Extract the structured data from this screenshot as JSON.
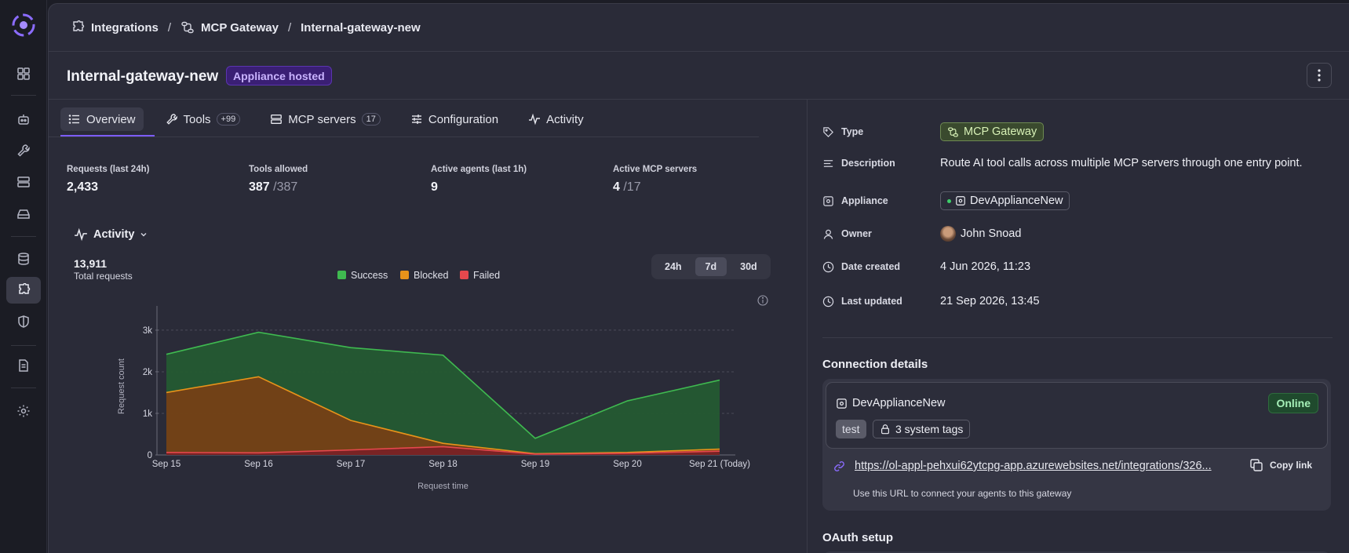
{
  "breadcrumb": {
    "items": [
      {
        "label": "Integrations",
        "icon": "puzzle-icon"
      },
      {
        "label": "MCP Gateway",
        "icon": "gateway-icon"
      },
      {
        "label": "Internal-gateway-new"
      }
    ],
    "separator": "/"
  },
  "page": {
    "title": "Internal-gateway-new",
    "hosted_badge": "Appliance hosted"
  },
  "tabs": [
    {
      "label": "Overview",
      "icon": "list-icon",
      "active": true
    },
    {
      "label": "Tools",
      "icon": "wrench-icon",
      "count": "+99"
    },
    {
      "label": "MCP servers",
      "icon": "server-icon",
      "count": "17"
    },
    {
      "label": "Configuration",
      "icon": "sliders-icon"
    },
    {
      "label": "Activity",
      "icon": "pulse-icon"
    }
  ],
  "metrics": [
    {
      "label": "Requests (last 24h)",
      "value": "2,433",
      "sub": ""
    },
    {
      "label": "Tools allowed",
      "value": "387",
      "sub": "/387"
    },
    {
      "label": "Active agents (last 1h)",
      "value": "9",
      "sub": ""
    },
    {
      "label": "Active MCP servers",
      "value": "4",
      "sub": "/17"
    }
  ],
  "activity": {
    "header": "Activity",
    "total_value": "13,911",
    "total_label": "Total requests",
    "ranges": [
      "24h",
      "7d",
      "30d"
    ],
    "selected_range": "7d"
  },
  "chart_data": {
    "type": "area",
    "x": [
      "Sep 15",
      "Sep 16",
      "Sep 17",
      "Sep 18",
      "Sep 19",
      "Sep 20",
      "Sep 21 (Today)"
    ],
    "series": [
      {
        "name": "Success",
        "color": "#3fb950",
        "values": [
          2420,
          2950,
          2580,
          2400,
          400,
          1300,
          1800
        ]
      },
      {
        "name": "Blocked",
        "color": "#e8931a",
        "values": [
          1500,
          1880,
          830,
          280,
          30,
          60,
          140
        ]
      },
      {
        "name": "Failed",
        "color": "#e5484d",
        "values": [
          60,
          50,
          120,
          200,
          20,
          40,
          90
        ]
      }
    ],
    "y_ticks": [
      "0",
      "1k",
      "2k",
      "3k"
    ],
    "ylim": [
      0,
      3300
    ],
    "xlabel": "Request time",
    "ylabel": "Request count",
    "legend_position": "top-center",
    "grid": true
  },
  "details": {
    "type_label": "Type",
    "type_value": "MCP Gateway",
    "description_label": "Description",
    "description_value": "Route AI tool calls across multiple MCP servers through one entry point.",
    "appliance_label": "Appliance",
    "appliance_value": "DevApplianceNew",
    "owner_label": "Owner",
    "owner_value": "John Snoad",
    "created_label": "Date created",
    "created_value": "4 Jun 2026, 11:23",
    "updated_label": "Last updated",
    "updated_value": "21 Sep 2026, 13:45"
  },
  "connection": {
    "title": "Connection details",
    "appliance": "DevApplianceNew",
    "status": "Online",
    "tag": "test",
    "system_tags": "3 system tags",
    "url": "https://ol-appl-pehxui62ytcpg-app.azurewebsites.net/integrations/326...",
    "copy_label": "Copy link",
    "help": "Use this URL to connect your agents to this gateway"
  },
  "oauth": {
    "title": "OAuth setup"
  }
}
